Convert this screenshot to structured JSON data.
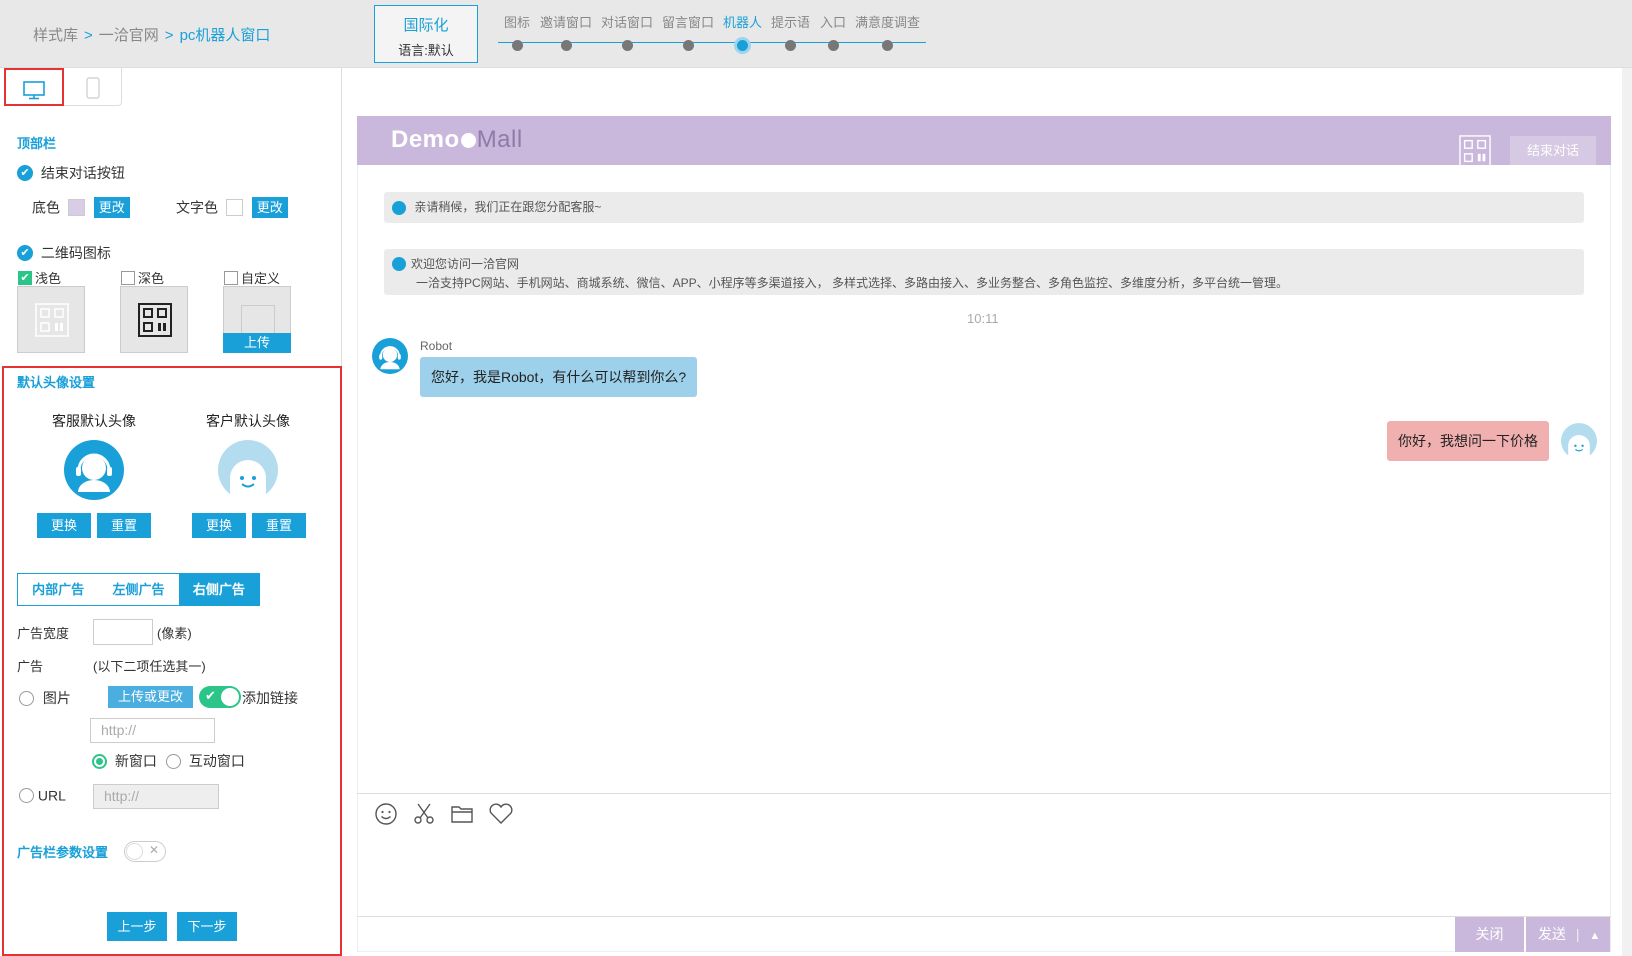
{
  "breadcrumb": {
    "root": "样式库",
    "sep": ">",
    "mid": "一洽官网",
    "current": "pc机器人窗口"
  },
  "intl": {
    "title": "国际化",
    "lang": "语言:默认"
  },
  "steps": [
    {
      "label": "图标"
    },
    {
      "label": "邀请窗口"
    },
    {
      "label": "对话窗口"
    },
    {
      "label": "留言窗口"
    },
    {
      "label": "机器人",
      "active": true
    },
    {
      "label": "提示语"
    },
    {
      "label": "入口"
    },
    {
      "label": "满意度调查"
    }
  ],
  "left": {
    "topbar_title": "顶部栏",
    "end_btn_label": "结束对话按钮",
    "bg_color_label": "底色",
    "text_color_label": "文字色",
    "change": "更改",
    "bg_color": "#d9cce6",
    "text_color": "#ffffff",
    "qr_label": "二维码图标",
    "qr_light": "浅色",
    "qr_dark": "深色",
    "qr_custom": "自定义",
    "upload": "上传",
    "avatar_title": "默认头像设置",
    "agent_avatar": "客服默认头像",
    "customer_avatar": "客户默认头像",
    "replace": "更换",
    "reset": "重置",
    "tabs": [
      "内部广告",
      "左侧广告",
      "右侧广告"
    ],
    "ad_width_label": "广告宽度",
    "pixel": "(像素)",
    "ad_label": "广告",
    "ad_hint": "(以下二项任选其一)",
    "image_label": "图片",
    "upload_change": "上传或更改",
    "add_link": "添加链接",
    "link_placeholder": "http://",
    "new_window": "新窗口",
    "interactive_window": "互动窗口",
    "url_label": "URL",
    "url_placeholder": "http://",
    "ad_param": "广告栏参数设置",
    "prev": "上一步",
    "next": "下一步"
  },
  "preview": {
    "logo_a": "Demo",
    "logo_b": "Mall",
    "end_chat": "结束对话",
    "sys1": "亲请稍候，我们正在跟您分配客服~",
    "sys2_title": "欢迎您访问一洽官网",
    "sys2_body": "一洽支持PC网站、手机网站、商城系统、微信、APP、小程序等多渠道接入， 多样式选择、多路由接入、多业务整合、多角色监控、多维度分析，多平台统一管理。",
    "time": "10:11",
    "robot_name": "Robot",
    "robot_msg": "您好，我是Robot，有什么可以帮到你么?",
    "user_msg": "你好，我想问一下价格",
    "close": "关闭",
    "send": "发送",
    "send_arrow": "▲",
    "theme_color": "#c9b8dc",
    "accent": "#1aa0d8"
  }
}
